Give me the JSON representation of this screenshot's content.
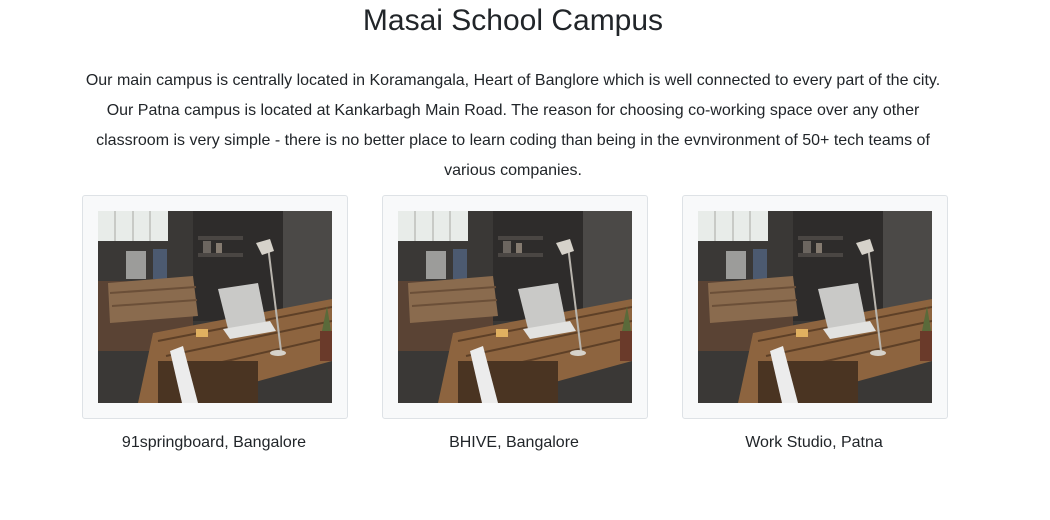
{
  "page": {
    "title": "Masai School Campus",
    "intro": "Our main campus is centrally located in Koramangala, Heart of Banglore which is well connected to every part of the city. Our Patna campus is located at Kankarbagh Main Road. The reason for choosing co-working space over any other classroom is very simple - there is no better place to learn coding than being in the evnvironment of 50+ tech teams of various companies."
  },
  "campuses": [
    {
      "name": "91springboard, Bangalore",
      "image_alt": "co-working desk with laptop and lamp"
    },
    {
      "name": "BHIVE, Bangalore",
      "image_alt": "co-working desk with laptop and lamp"
    },
    {
      "name": "Work Studio, Patna",
      "image_alt": "co-working desk with laptop and lamp"
    }
  ],
  "colors": {
    "text": "#212529",
    "card_border": "#dee2e6",
    "card_background": "#f8f9fa"
  }
}
